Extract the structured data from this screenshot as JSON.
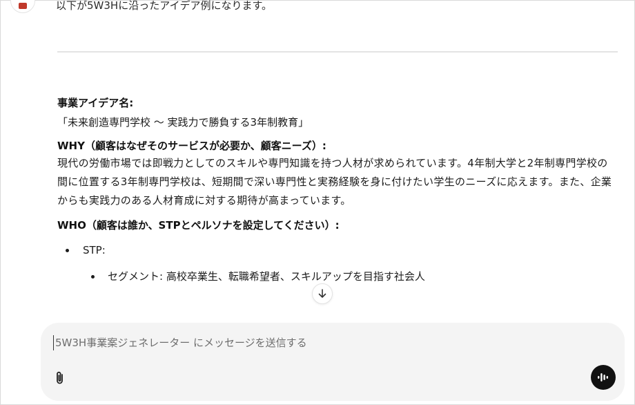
{
  "header": {
    "intro_text": "以下が5W3Hに沿ったアイデア例になります。"
  },
  "message": {
    "idea_heading": "事業アイデア名:",
    "idea_name": "「未来創造専門学校 ～ 実践力で勝負する3年制教育」",
    "why_heading": "WHY（顧客はなぜそのサービスが必要か、顧客ニーズ）:",
    "why_body": "現代の労働市場では即戦力としてのスキルや専門知識を持つ人材が求められています。4年制大学と2年制専門学校の間に位置する3年制専門学校は、短期間で深い専門性と実務経験を身に付けたい学生のニーズに応えます。また、企業からも実践力のある人材育成に対する期待が高まっています。",
    "who_heading": "WHO（顧客は誰か、STPとペルソナを設定してください）:",
    "stp_label": "STP:",
    "segment_text": "セグメント: 高校卒業生、転職希望者、スキルアップを目指す社会人"
  },
  "composer": {
    "placeholder": "5W3H事業案ジェネレーター にメッセージを送信する"
  },
  "icons": {
    "scroll_down": "arrow-down-icon",
    "attach": "paperclip-icon",
    "voice": "voice-waveform-icon"
  },
  "colors": {
    "composer_bg": "#f4f4f4",
    "voice_button": "#111111",
    "avatar_accent": "#c0392b"
  }
}
